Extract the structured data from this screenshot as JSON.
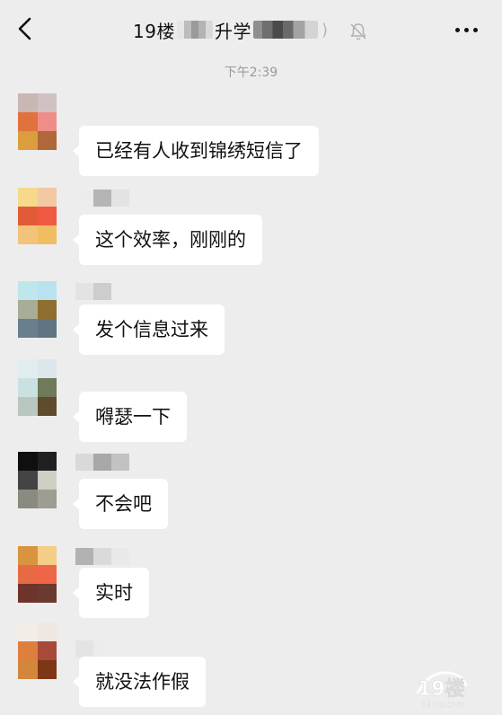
{
  "header": {
    "title_prefix": "19楼",
    "title_middle": "升学",
    "title_suffix": ")",
    "back_icon": "chevron-left-icon",
    "mute_icon": "bell-muted-icon",
    "more_icon": "more-dots-icon"
  },
  "timestamp": "下午2:39",
  "messages": [
    {
      "text": "已经有人收到锦绣短信了"
    },
    {
      "text": "这个效率，刚刚的"
    },
    {
      "text": "发个信息过来"
    },
    {
      "text": "嘚瑟一下"
    },
    {
      "text": "不会吧"
    },
    {
      "text": "实时"
    },
    {
      "text": "就没法作假"
    }
  ],
  "watermark": {
    "logo": "19楼",
    "site": "19lou.com"
  }
}
